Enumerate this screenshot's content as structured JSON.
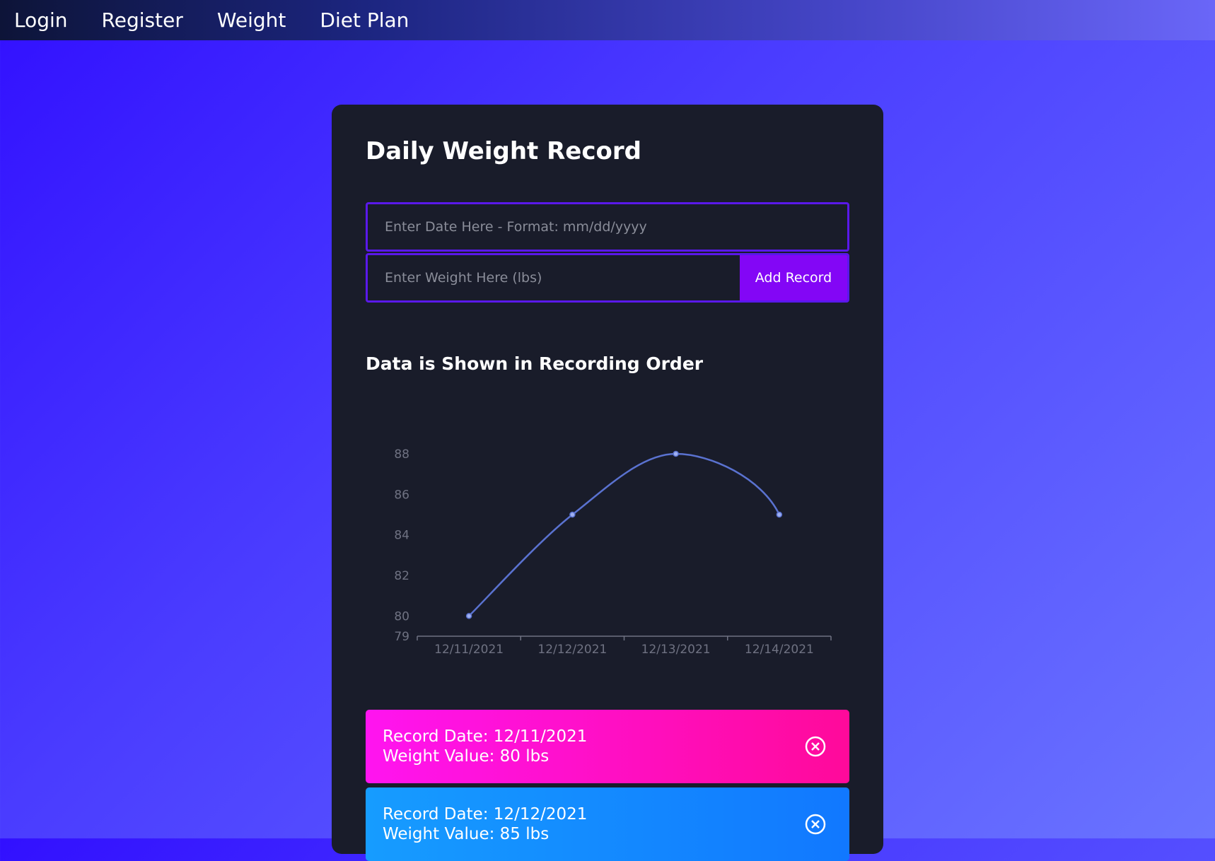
{
  "nav": {
    "items": [
      {
        "label": "Login"
      },
      {
        "label": "Register"
      },
      {
        "label": "Weight"
      },
      {
        "label": "Diet Plan"
      }
    ]
  },
  "card": {
    "title": "Daily Weight Record",
    "date_placeholder": "Enter Date Here - Format: mm/dd/yyyy",
    "weight_placeholder": "Enter Weight Here (lbs)",
    "add_button_label": "Add Record",
    "chart_heading": "Data is Shown in Recording Order"
  },
  "chart_data": {
    "type": "line",
    "categories": [
      "12/11/2021",
      "12/12/2021",
      "12/13/2021",
      "12/14/2021"
    ],
    "values": [
      80,
      85,
      88,
      85
    ],
    "yticks": [
      79,
      80,
      82,
      84,
      86,
      88
    ],
    "ylim": [
      79,
      88
    ],
    "grid": false,
    "smooth": true,
    "colors": {
      "line": "#5a72d0",
      "tick_text": "#6f7282",
      "axis": "#6f7282"
    }
  },
  "records": [
    {
      "date_label": "Record Date: 12/11/2021",
      "weight_label": "Weight Value: 80 lbs"
    },
    {
      "date_label": "Record Date: 12/12/2021",
      "weight_label": "Weight Value: 85 lbs"
    }
  ]
}
